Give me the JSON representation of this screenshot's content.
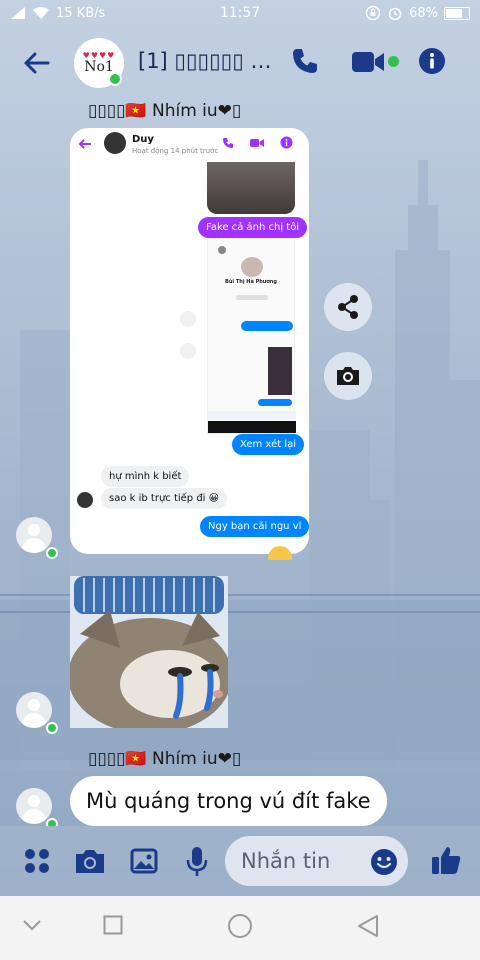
{
  "status_bar": {
    "network_speed": "15 KB/s",
    "time": "11:57",
    "battery": "68%",
    "battery_level": 0.68
  },
  "header": {
    "title": "[1] ▯▯▯▯▯▯ ▯...",
    "group_avatar_text": "No1",
    "group_avatar_hearts": "♥♥♥♥"
  },
  "messages": {
    "sender_name_1": "▯▯▯▯🇻🇳 Nhím iu❤▯",
    "sender_name_2": "▯▯▯▯🇻🇳 Nhím iu❤▯",
    "last_message": "Mù quáng trong vú đít fake"
  },
  "screenshot": {
    "contact_name": "Duy",
    "contact_status": "Hoạt động 14 phút trước",
    "msg_fake": "Fake cả ảnh chị tôi",
    "inner_profile_name": "Bùi Thị Hà Phương",
    "msg_review": "Xem xét lại",
    "msg_dunno": "hự mình k biết",
    "msg_why": "sao k ib trực tiếp đi 😀",
    "msg_argue": "Ngy bạn cãi ngu vl"
  },
  "composer": {
    "placeholder": "Nhắn tin"
  },
  "colors": {
    "accent": "#1b3a8a",
    "online": "#31c24d",
    "messenger_purple": "#a033ff",
    "messenger_blue": "#0084ff"
  },
  "icons": [
    "back-arrow-icon",
    "phone-icon",
    "video-icon",
    "info-icon",
    "share-icon",
    "camera-icon",
    "apps-icon",
    "photo-icon",
    "mic-icon",
    "emoji-icon",
    "like-icon",
    "wifi-icon",
    "signal-icon",
    "alarm-icon",
    "lock-rotation-icon"
  ]
}
